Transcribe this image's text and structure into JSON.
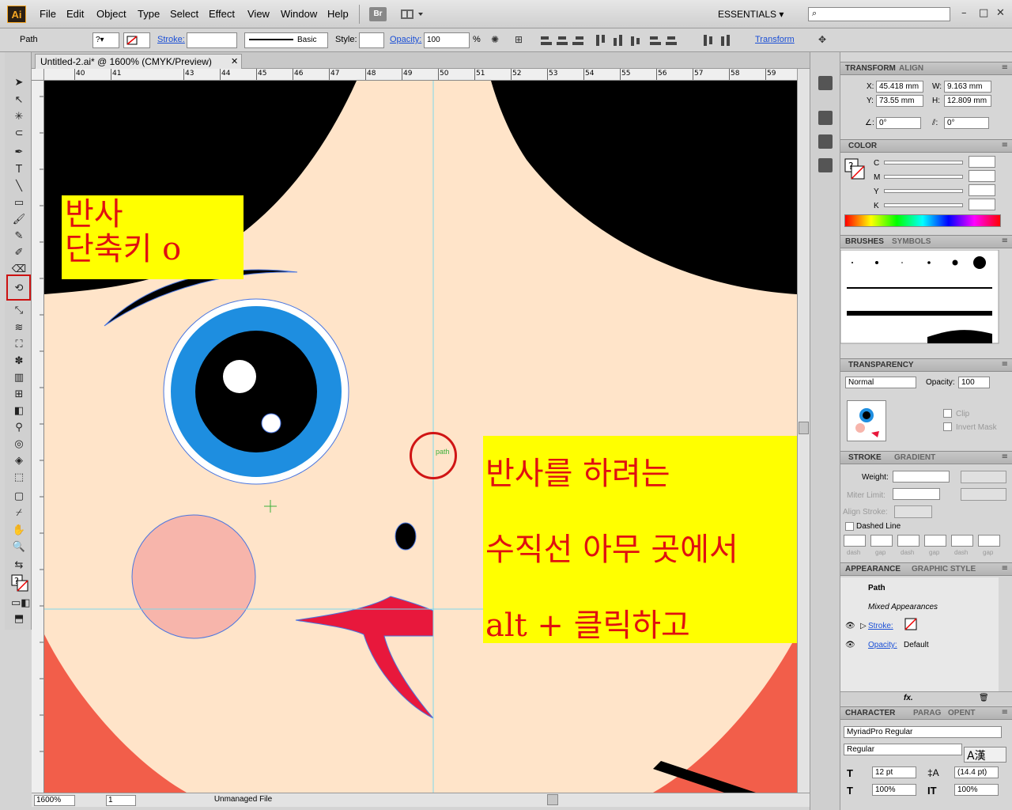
{
  "app": {
    "logo": "Ai"
  },
  "menu": [
    "File",
    "Edit",
    "Object",
    "Type",
    "Select",
    "Effect",
    "View",
    "Window",
    "Help"
  ],
  "menubar": {
    "bridge": "Br",
    "workspace": "ESSENTIALS"
  },
  "control": {
    "selection": "Path",
    "stroke_label": "Stroke:",
    "brush": "Basic",
    "style_label": "Style:",
    "opacity_label": "Opacity:",
    "opacity_value": "100",
    "percent": "%",
    "transform_link": "Transform"
  },
  "document": {
    "tab_title": "Untitled-2.ai* @ 1600% (CMYK/Preview)"
  },
  "ruler": {
    "ticks": [
      "40",
      "41",
      "43",
      "44",
      "45",
      "46",
      "47",
      "48",
      "49",
      "50",
      "51",
      "52",
      "53",
      "54",
      "55",
      "56",
      "57",
      "58",
      "59"
    ]
  },
  "annotations": {
    "box1": "반사\n단축키 o",
    "box2": "반사를 하려는\n수직선 아무 곳에서\nalt + 클릭하고",
    "path_tip": "path"
  },
  "statusbar": {
    "zoom": "1600%",
    "page": "1",
    "file": "Unmanaged File"
  },
  "panels": {
    "transform": {
      "tabs": [
        "TRANSFORM",
        "ALIGN"
      ],
      "x": "45.418 mm",
      "y": "73.55 mm",
      "w": "9.163 mm",
      "h": "12.809 mm",
      "rotate": "0°",
      "shear": "0°",
      "x_label": "X:",
      "y_label": "Y:",
      "w_label": "W:",
      "h_label": "H:"
    },
    "color": {
      "tab": "COLOR",
      "channels": [
        "C",
        "M",
        "Y",
        "K"
      ]
    },
    "brushes": {
      "tabs": [
        "BRUSHES",
        "SYMBOLS"
      ]
    },
    "transparency": {
      "tab": "TRANSPARENCY",
      "mode": "Normal",
      "opacity_label": "Opacity:",
      "opacity": "100",
      "clip": "Clip",
      "invert_mask": "Invert Mask"
    },
    "stroke": {
      "tabs": [
        "STROKE",
        "GRADIENT"
      ],
      "weight_label": "Weight:",
      "miter_label": "Miter Limit:",
      "align_label": "Align Stroke:",
      "dashed_line": "Dashed Line",
      "dash_labels": [
        "dash",
        "gap",
        "dash",
        "gap",
        "dash",
        "gap"
      ]
    },
    "appearance": {
      "tabs": [
        "APPEARANCE",
        "GRAPHIC STYLE"
      ],
      "path": "Path",
      "mixed": "Mixed Appearances",
      "stroke_label": "Stroke:",
      "opacity_label": "Opacity:",
      "opacity_value": "Default"
    },
    "character": {
      "tabs": [
        "CHARACTER",
        "PARAG",
        "OPENT"
      ],
      "font": "MyriadPro Regular",
      "style": "Regular",
      "size": "12 pt",
      "leading": "(14.4 pt)",
      "hscale": "100%",
      "vscale": "100%",
      "ime": "A漢"
    }
  },
  "colors": {
    "skin": "#ffe4c9",
    "hair": "#000000",
    "cheek": "#f7b5ab",
    "iris": "#1e8ee0",
    "lip": "#e8183c",
    "corner": "#f25e4a",
    "annotation_bg": "#ffff00",
    "annotation_text": "#e01010"
  }
}
